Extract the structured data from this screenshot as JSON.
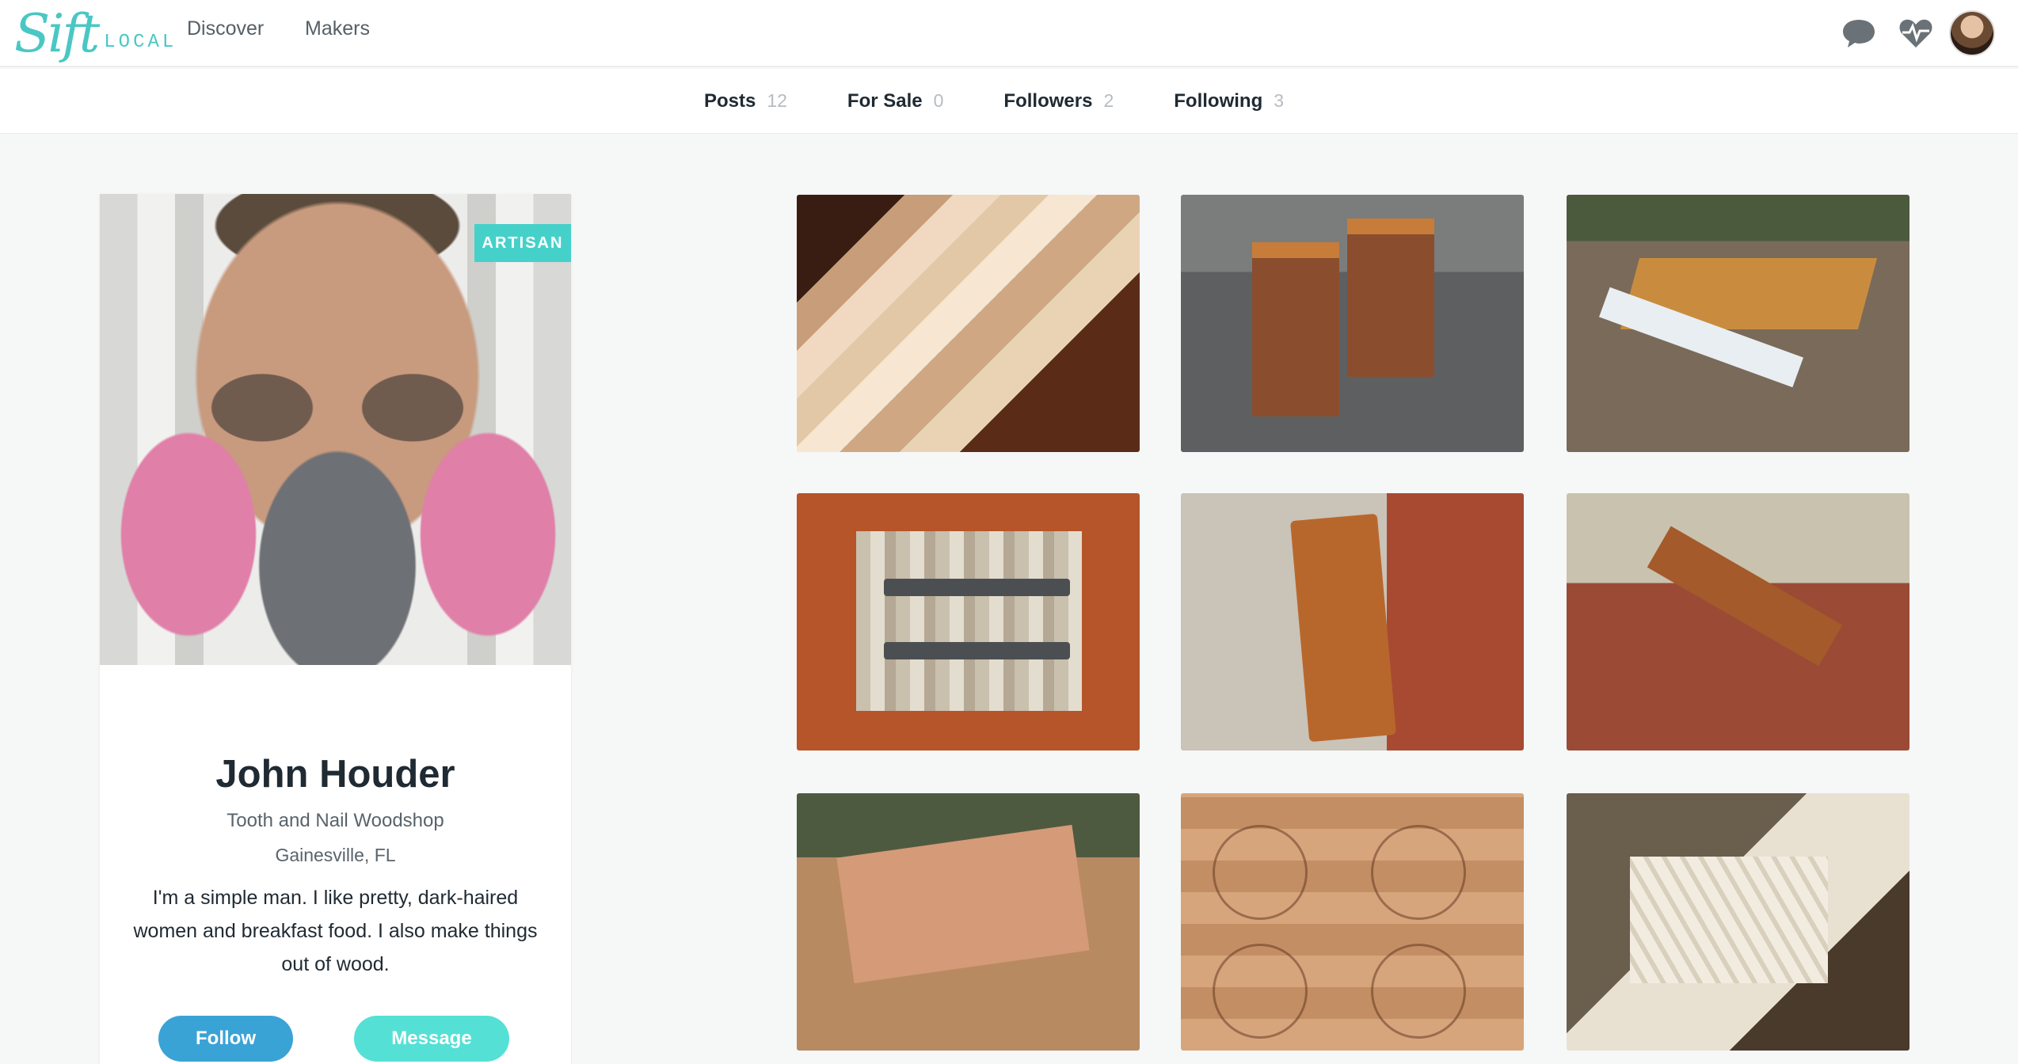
{
  "topnav": {
    "logo_script": "Sift",
    "logo_local": "LOCAL",
    "links": [
      "Discover",
      "Makers"
    ],
    "icons": [
      "chat-bubble-icon",
      "heart-pulse-icon",
      "user-avatar"
    ]
  },
  "subnav": {
    "tabs": [
      {
        "label": "Posts",
        "count": "12"
      },
      {
        "label": "For Sale",
        "count": "0"
      },
      {
        "label": "Followers",
        "count": "2"
      },
      {
        "label": "Following",
        "count": "3"
      }
    ]
  },
  "profile": {
    "badge": "ARTISAN",
    "name": "John Houder",
    "shop": "Tooth and Nail Woodshop",
    "location": "Gainesville, FL",
    "bio": "I'm a simple man. I like pretty, dark-haired women and breakfast food. I also make things out of wood.",
    "follow_label": "Follow",
    "message_label": "Message"
  },
  "colors": {
    "accent_teal": "#45d1c9",
    "follow_blue": "#3aa3d6",
    "message_teal": "#55e0d5"
  },
  "posts_grid": {
    "items": [
      "cutting-board-photo",
      "side-tables-photo",
      "picnic-table-photo",
      "knife-fork-wall-art-photo",
      "bottle-opener-photo",
      "coffee-table-photo",
      "wood-rack-photo",
      "engraved-coasters-photo",
      "wood-slats-photo"
    ]
  }
}
